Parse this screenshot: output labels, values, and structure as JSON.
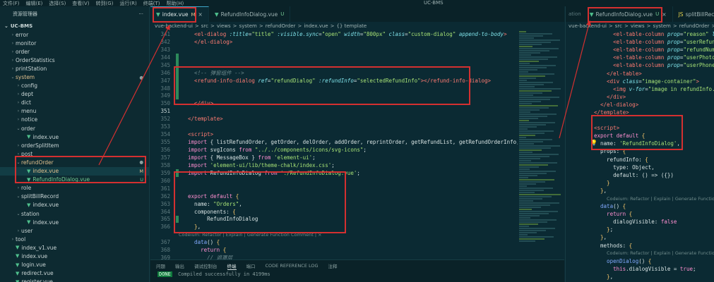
{
  "window": {
    "title": "UC-BMS"
  },
  "menu": [
    "文件(F)",
    "编辑(E)",
    "选择(S)",
    "查看(V)",
    "转到(G)",
    "运行(R)",
    "终端(T)",
    "帮助(H)"
  ],
  "sidebar": {
    "title": "资源管理器",
    "more": "···",
    "root": "UC-BMS",
    "items": [
      {
        "label": "error",
        "depth": 1,
        "kind": "folder",
        "open": false
      },
      {
        "label": "monitor",
        "depth": 1,
        "kind": "folder",
        "open": false
      },
      {
        "label": "order",
        "depth": 1,
        "kind": "folder",
        "open": false
      },
      {
        "label": "OrderStatistics",
        "depth": 1,
        "kind": "folder",
        "open": false
      },
      {
        "label": "printStation",
        "depth": 1,
        "kind": "folder",
        "open": false
      },
      {
        "label": "system",
        "depth": 1,
        "kind": "folder",
        "open": true,
        "status": "dot",
        "state": "mod"
      },
      {
        "label": "config",
        "depth": 2,
        "kind": "folder",
        "open": false
      },
      {
        "label": "dept",
        "depth": 2,
        "kind": "folder",
        "open": false
      },
      {
        "label": "dict",
        "depth": 2,
        "kind": "folder",
        "open": false
      },
      {
        "label": "menu",
        "depth": 2,
        "kind": "folder",
        "open": false
      },
      {
        "label": "notice",
        "depth": 2,
        "kind": "folder",
        "open": false
      },
      {
        "label": "order",
        "depth": 2,
        "kind": "folder",
        "open": true
      },
      {
        "label": "index.vue",
        "depth": 3,
        "kind": "vue"
      },
      {
        "label": "orderSplitItem",
        "depth": 2,
        "kind": "folder",
        "open": false
      },
      {
        "label": "post",
        "depth": 2,
        "kind": "folder",
        "open": false
      },
      {
        "label": "refundOrder",
        "depth": 2,
        "kind": "folder",
        "open": true,
        "status": "dot",
        "state": "mod"
      },
      {
        "label": "index.vue",
        "depth": 3,
        "kind": "vue",
        "status": "M",
        "state": "mod",
        "selected": true
      },
      {
        "label": "RefundInfoDialog.vue",
        "depth": 3,
        "kind": "vue",
        "status": "U",
        "state": "unt"
      },
      {
        "label": "role",
        "depth": 2,
        "kind": "folder",
        "open": false
      },
      {
        "label": "splitBillRecord",
        "depth": 2,
        "kind": "folder",
        "open": true
      },
      {
        "label": "index.vue",
        "depth": 3,
        "kind": "vue"
      },
      {
        "label": "station",
        "depth": 2,
        "kind": "folder",
        "open": true
      },
      {
        "label": "index.vue",
        "depth": 3,
        "kind": "vue"
      },
      {
        "label": "user",
        "depth": 2,
        "kind": "folder",
        "open": false
      },
      {
        "label": "tool",
        "depth": 1,
        "kind": "folder",
        "open": false
      },
      {
        "label": "index_v1.vue",
        "depth": 1,
        "kind": "vue"
      },
      {
        "label": "index.vue",
        "depth": 1,
        "kind": "vue"
      },
      {
        "label": "login.vue",
        "depth": 1,
        "kind": "vue"
      },
      {
        "label": "redirect.vue",
        "depth": 1,
        "kind": "vue"
      },
      {
        "label": "register.vue",
        "depth": 1,
        "kind": "vue"
      }
    ]
  },
  "editor1": {
    "tabs": [
      {
        "label": "index.vue",
        "status": "M",
        "active": true,
        "close": "×"
      },
      {
        "label": "RefundInfoDialog.vue",
        "status": "U",
        "active": false
      }
    ],
    "breadcrumbs": [
      "vue-backend-ui",
      ">",
      "src",
      ">",
      "views",
      ">",
      "system",
      ">",
      "refundOrder",
      ">",
      "index.vue",
      ">",
      "{} template"
    ],
    "lines": [
      {
        "n": "341",
        "gut": "",
        "tokens": [
          [
            "t-tag",
            "    <el-dialog "
          ],
          [
            "t-attr",
            ":title"
          ],
          [
            "t-plain",
            "="
          ],
          [
            "t-str",
            "\"title\""
          ],
          [
            "t-attr",
            " :visible.sync"
          ],
          [
            "t-plain",
            "="
          ],
          [
            "t-str",
            "\"open\""
          ],
          [
            "t-attr",
            " width"
          ],
          [
            "t-plain",
            "="
          ],
          [
            "t-str",
            "\"800px\""
          ],
          [
            "t-attr",
            " class"
          ],
          [
            "t-plain",
            "="
          ],
          [
            "t-str",
            "\"custom-dialog\""
          ],
          [
            "t-attr",
            " append-to-body"
          ],
          [
            "t-tag",
            ">"
          ]
        ]
      },
      {
        "n": "342",
        "gut": "",
        "tokens": [
          [
            "t-tag",
            "    </el-dialog>"
          ]
        ]
      },
      {
        "n": "343",
        "gut": "",
        "tokens": []
      },
      {
        "n": "344",
        "gut": "g",
        "tokens": []
      },
      {
        "n": "345",
        "gut": "g",
        "tokens": []
      },
      {
        "n": "346",
        "gut": "g",
        "tokens": [
          [
            "t-com",
            "    <!-- 弹窗组件 -->"
          ]
        ]
      },
      {
        "n": "347",
        "gut": "g",
        "tokens": [
          [
            "t-tag",
            "    <refund-info-dialog "
          ],
          [
            "t-attr",
            "ref"
          ],
          [
            "t-plain",
            "="
          ],
          [
            "t-str",
            "\"refundDialog\""
          ],
          [
            "t-attr",
            " :refundInfo"
          ],
          [
            "t-plain",
            "="
          ],
          [
            "t-str",
            "\"selectedRefundInfo\""
          ],
          [
            "t-tag",
            "></refund-info-dialog>"
          ]
        ]
      },
      {
        "n": "348",
        "gut": "g",
        "tokens": []
      },
      {
        "n": "349",
        "gut": "g",
        "tokens": []
      },
      {
        "n": "350",
        "gut": "",
        "tokens": [
          [
            "t-tag",
            "    </div>"
          ]
        ]
      },
      {
        "n": "351",
        "gut": "",
        "cur": true,
        "tokens": []
      },
      {
        "n": "352",
        "gut": "",
        "tokens": [
          [
            "t-tag",
            "  </template>"
          ]
        ]
      },
      {
        "n": "353",
        "gut": "",
        "tokens": []
      },
      {
        "n": "354",
        "gut": "",
        "tokens": [
          [
            "t-tag",
            "  <script>"
          ]
        ]
      },
      {
        "n": "355",
        "gut": "",
        "tokens": [
          [
            "t-kw",
            "  import "
          ],
          [
            "t-plain",
            "{ listRefundOrder, getOrder, delOrder, addOrder, reprintOrder, getRefundList, getRefundOrderInfo,getRefundInfo } "
          ],
          [
            "t-kw",
            "from "
          ],
          [
            "t-str",
            "\"@/"
          ]
        ]
      },
      {
        "n": "356",
        "gut": "",
        "tokens": [
          [
            "t-kw",
            "  import "
          ],
          [
            "t-plain",
            "svgIcons "
          ],
          [
            "t-kw",
            "from "
          ],
          [
            "t-str",
            "\"../../components/icons/svg-icons\""
          ],
          [
            "t-plain",
            ";"
          ]
        ]
      },
      {
        "n": "357",
        "gut": "",
        "tokens": [
          [
            "t-kw",
            "  import "
          ],
          [
            "t-plain",
            "{ MessageBox } "
          ],
          [
            "t-kw",
            "from "
          ],
          [
            "t-str",
            "'element-ui'"
          ],
          [
            "t-plain",
            ";"
          ]
        ]
      },
      {
        "n": "358",
        "gut": "",
        "tokens": [
          [
            "t-kw",
            "  import "
          ],
          [
            "t-str",
            "'element-ui/lib/theme-chalk/index.css'"
          ],
          [
            "t-plain",
            ";"
          ]
        ]
      },
      {
        "n": "359",
        "gut": "g",
        "tokens": [
          [
            "t-kw",
            "  import "
          ],
          [
            "t-plain",
            "RefundInfoDialog "
          ],
          [
            "t-kw",
            "from "
          ],
          [
            "t-str",
            "'./RefundInfoDialog.vue'"
          ],
          [
            "t-plain",
            ";"
          ]
        ]
      },
      {
        "n": "360",
        "gut": "",
        "tokens": []
      },
      {
        "n": "361",
        "gut": "",
        "tokens": []
      },
      {
        "n": "362",
        "gut": "",
        "tokens": [
          [
            "t-kw",
            "  export default "
          ],
          [
            "t-yel",
            "{"
          ]
        ]
      },
      {
        "n": "363",
        "gut": "",
        "tokens": [
          [
            "t-plain",
            "    name: "
          ],
          [
            "t-str",
            "\"Orders\""
          ],
          [
            "t-plain",
            ","
          ]
        ]
      },
      {
        "n": "364",
        "gut": "",
        "tokens": [
          [
            "t-plain",
            "    components: "
          ],
          [
            "t-yel",
            "{"
          ]
        ]
      },
      {
        "n": "365",
        "gut": "g",
        "tokens": [
          [
            "t-plain",
            "        RefundInfoDialog"
          ]
        ]
      },
      {
        "n": "366",
        "gut": "",
        "tokens": [
          [
            "t-yel",
            "    }"
          ],
          [
            "t-plain",
            ","
          ]
        ]
      },
      {
        "codelens": "Codeium: Refactor | Explain | Generate Function Comment | ×"
      },
      {
        "n": "367",
        "gut": "",
        "tokens": [
          [
            "t-fn",
            "    data"
          ],
          [
            "t-plain",
            "() "
          ],
          [
            "t-yel",
            "{"
          ]
        ]
      },
      {
        "n": "368",
        "gut": "",
        "tokens": [
          [
            "t-kw",
            "      return "
          ],
          [
            "t-yel",
            "{"
          ]
        ]
      },
      {
        "n": "369",
        "gut": "",
        "tokens": [
          [
            "t-com",
            "        // 遮罩层"
          ]
        ]
      }
    ]
  },
  "panel": {
    "tabs": [
      "问题",
      "输出",
      "调试控制台",
      "终端",
      "端口",
      "CODE REFERENCE LOG",
      "注释"
    ],
    "active": "终端",
    "terminal_badge": "DONE",
    "terminal_text": "Compiled successfully in 4199ms"
  },
  "editor2": {
    "tabs": [
      {
        "label": "RefundInfoDialog.vue",
        "status": "U",
        "close": "×"
      },
      {
        "label": "splitBillRecord.js"
      }
    ],
    "faint_tab": "ation",
    "breadcrumbs": [
      "vue-backend-ui",
      ">",
      "src",
      ">",
      "views",
      ">",
      "system",
      ">",
      "refundOrder",
      ">",
      "R"
    ],
    "lines": [
      {
        "tokens": [
          [
            "t-tag",
            "      <el-table-column "
          ],
          [
            "t-attr",
            "prop"
          ],
          [
            "t-plain",
            "="
          ],
          [
            "t-str",
            "\"reason\""
          ],
          [
            "t-attr",
            " lab"
          ]
        ]
      },
      {
        "tokens": [
          [
            "t-tag",
            "      <el-table-column "
          ],
          [
            "t-attr",
            "prop"
          ],
          [
            "t-plain",
            "="
          ],
          [
            "t-str",
            "\"userRefundR"
          ]
        ]
      },
      {
        "tokens": [
          [
            "t-tag",
            "      <el-table-column "
          ],
          [
            "t-attr",
            "prop"
          ],
          [
            "t-plain",
            "="
          ],
          [
            "t-str",
            "\"refundNum\""
          ]
        ]
      },
      {
        "tokens": [
          [
            "t-tag",
            "      <el-table-column "
          ],
          [
            "t-attr",
            "prop"
          ],
          [
            "t-plain",
            "="
          ],
          [
            "t-str",
            "\"userPhotoUr"
          ]
        ]
      },
      {
        "tokens": [
          [
            "t-tag",
            "      <el-table-column "
          ],
          [
            "t-attr",
            "prop"
          ],
          [
            "t-plain",
            "="
          ],
          [
            "t-str",
            "\"userPhone\""
          ]
        ]
      },
      {
        "tokens": [
          [
            "t-tag",
            "    </el-table>"
          ]
        ]
      },
      {
        "tokens": [
          [
            "t-tag",
            "    <div "
          ],
          [
            "t-attr",
            "class"
          ],
          [
            "t-plain",
            "="
          ],
          [
            "t-str",
            "\"image-container\""
          ],
          [
            "t-tag",
            ">"
          ]
        ]
      },
      {
        "tokens": [
          [
            "t-tag",
            "      <img "
          ],
          [
            "t-attr",
            "v-for"
          ],
          [
            "t-plain",
            "="
          ],
          [
            "t-str",
            "\"image in refundInfo.im"
          ]
        ]
      },
      {
        "tokens": [
          [
            "t-tag",
            "    </div>"
          ]
        ]
      },
      {
        "tokens": [
          [
            "t-tag",
            "  </el-dialog>"
          ]
        ]
      },
      {
        "tokens": [
          [
            "t-tag",
            "</template>"
          ]
        ]
      },
      {
        "tokens": []
      },
      {
        "tokens": [
          [
            "t-tag",
            "<script>"
          ]
        ]
      },
      {
        "tokens": [
          [
            "t-kw",
            "export default "
          ],
          [
            "t-yel",
            "{"
          ]
        ]
      },
      {
        "tokens": [
          [
            "t-plain",
            "  name: "
          ],
          [
            "t-str",
            "'RefundInfoDialog'"
          ],
          [
            "t-plain",
            ","
          ]
        ]
      },
      {
        "tokens": [
          [
            "t-plain",
            "  props: "
          ],
          [
            "t-yel",
            "{"
          ]
        ]
      },
      {
        "tokens": [
          [
            "t-plain",
            "    refundInfo: "
          ],
          [
            "t-yel",
            "{"
          ]
        ]
      },
      {
        "tokens": [
          [
            "t-plain",
            "      type: Object,"
          ]
        ]
      },
      {
        "tokens": [
          [
            "t-plain",
            "      default: () => ({})"
          ]
        ]
      },
      {
        "tokens": [
          [
            "t-yel",
            "    }"
          ]
        ]
      },
      {
        "tokens": [
          [
            "t-yel",
            "  }"
          ],
          [
            "t-plain",
            ","
          ]
        ]
      },
      {
        "codelens": "Codeium: Refactor | Explain | Generate Function Comm"
      },
      {
        "tokens": [
          [
            "t-fn",
            "  data"
          ],
          [
            "t-plain",
            "() "
          ],
          [
            "t-yel",
            "{"
          ]
        ]
      },
      {
        "tokens": [
          [
            "t-kw",
            "    return "
          ],
          [
            "t-yel",
            "{"
          ]
        ]
      },
      {
        "tokens": [
          [
            "t-plain",
            "      dialogVisible: "
          ],
          [
            "t-kw",
            "false"
          ]
        ]
      },
      {
        "tokens": [
          [
            "t-yel",
            "    }"
          ],
          [
            "t-plain",
            ";"
          ]
        ]
      },
      {
        "tokens": [
          [
            "t-yel",
            "  }"
          ],
          [
            "t-plain",
            ","
          ]
        ]
      },
      {
        "tokens": [
          [
            "t-plain",
            "  methods: "
          ],
          [
            "t-yel",
            "{"
          ]
        ]
      },
      {
        "codelens": "Codeium: Refactor | Explain | Generate Function Comm"
      },
      {
        "tokens": [
          [
            "t-fn",
            "    openDialog"
          ],
          [
            "t-plain",
            "() "
          ],
          [
            "t-yel",
            "{"
          ]
        ]
      },
      {
        "tokens": [
          [
            "t-kw",
            "      this"
          ],
          [
            "t-plain",
            ".dialogVisible = "
          ],
          [
            "t-kw",
            "true"
          ],
          [
            "t-plain",
            ";"
          ]
        ]
      },
      {
        "tokens": [
          [
            "t-yel",
            "    }"
          ],
          [
            "t-plain",
            ","
          ]
        ]
      }
    ]
  },
  "icons": {
    "vue_file": "vue-file-icon",
    "folder_chevron": "chevron-icon",
    "lightbulb": "lightbulb-icon"
  },
  "colors": {
    "annotation_red": "#d43030",
    "vue_green": "#4fc08d",
    "modified": "#e2c08d",
    "untracked": "#73c991"
  }
}
